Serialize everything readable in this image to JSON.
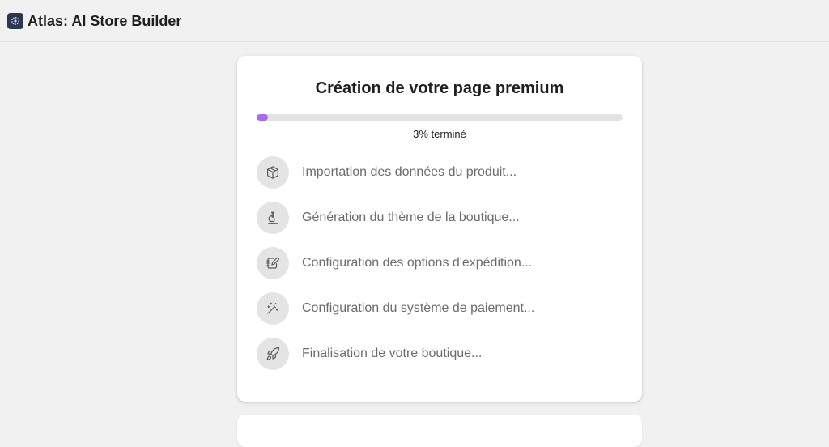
{
  "header": {
    "app_title": "Atlas: AI Store Builder",
    "logo_icon": "atlas-logo-icon"
  },
  "card": {
    "title": "Création de votre page premium",
    "progress": {
      "percent": 3,
      "label": "3% terminé",
      "fill_color": "#a56bf5"
    },
    "steps": [
      {
        "icon": "package-icon",
        "label": "Importation des données du produit..."
      },
      {
        "icon": "microscope-icon",
        "label": "Génération du thème de la boutique..."
      },
      {
        "icon": "notebook-pen-icon",
        "label": "Configuration des options d'expédition..."
      },
      {
        "icon": "magic-wand-icon",
        "label": "Configuration du système de paiement..."
      },
      {
        "icon": "rocket-icon",
        "label": "Finalisation de votre boutique..."
      }
    ]
  }
}
